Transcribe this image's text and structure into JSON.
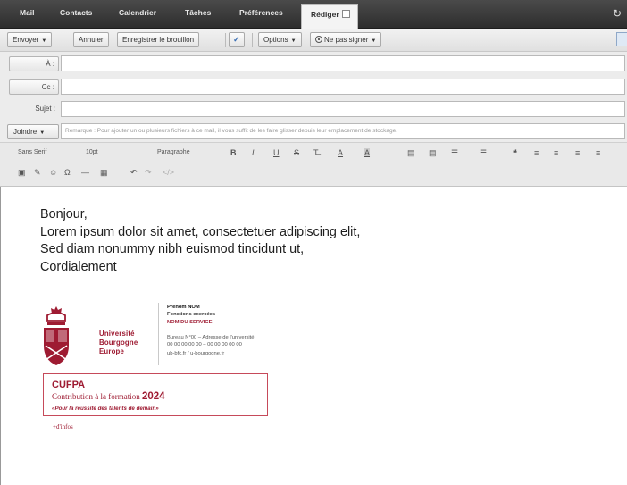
{
  "tabs": [
    {
      "label": "Mail"
    },
    {
      "label": "Contacts"
    },
    {
      "label": "Calendrier"
    },
    {
      "label": "Tâches"
    },
    {
      "label": "Préférences"
    },
    {
      "label": "Rédiger"
    }
  ],
  "toolbar": {
    "send": "Envoyer",
    "cancel": "Annuler",
    "save_draft": "Enregistrer le brouillon",
    "options": "Options",
    "no_sign": "Ne pas signer"
  },
  "fields": {
    "to_label": "À :",
    "cc_label": "Cc :",
    "subject_label": "Sujet :",
    "attach_label": "Joindre",
    "attach_hint": "Remarque : Pour ajouter un ou plusieurs fichiers à ce mail, il vous suffit de les faire glisser depuis leur emplacement de stockage."
  },
  "editor_toolbar": {
    "font_family": "Sans Serif",
    "font_size": "10pt",
    "paragraph": "Paragraphe"
  },
  "message": {
    "lines": [
      "Bonjour,",
      "Lorem ipsum dolor sit amet, consectetuer adipiscing elit,",
      "Sed diam nonummy nibh euismod tincidunt ut,",
      "Cordialement"
    ]
  },
  "signature": {
    "org": [
      "Université",
      "Bourgogne",
      "Europe"
    ],
    "name": "Prénom NOM",
    "role": "Fonctions exercées",
    "service": "NOM DU SERVICE",
    "address": "Bureau N°00 – Adresse de l'université",
    "phone": "00 00 00 00 00 – 00 00 00 00 00",
    "web": "ub-bfc.fr / u-bourgogne.fr",
    "box_title": "CUFPA",
    "box_sub": "Contribution à la formation",
    "box_year": "2024",
    "box_tag": "«Pour la réussite des talents de demain»",
    "more": "+d'infos"
  },
  "colors": {
    "brand": "#9e1b32",
    "topbar": "#3a3a3a"
  }
}
